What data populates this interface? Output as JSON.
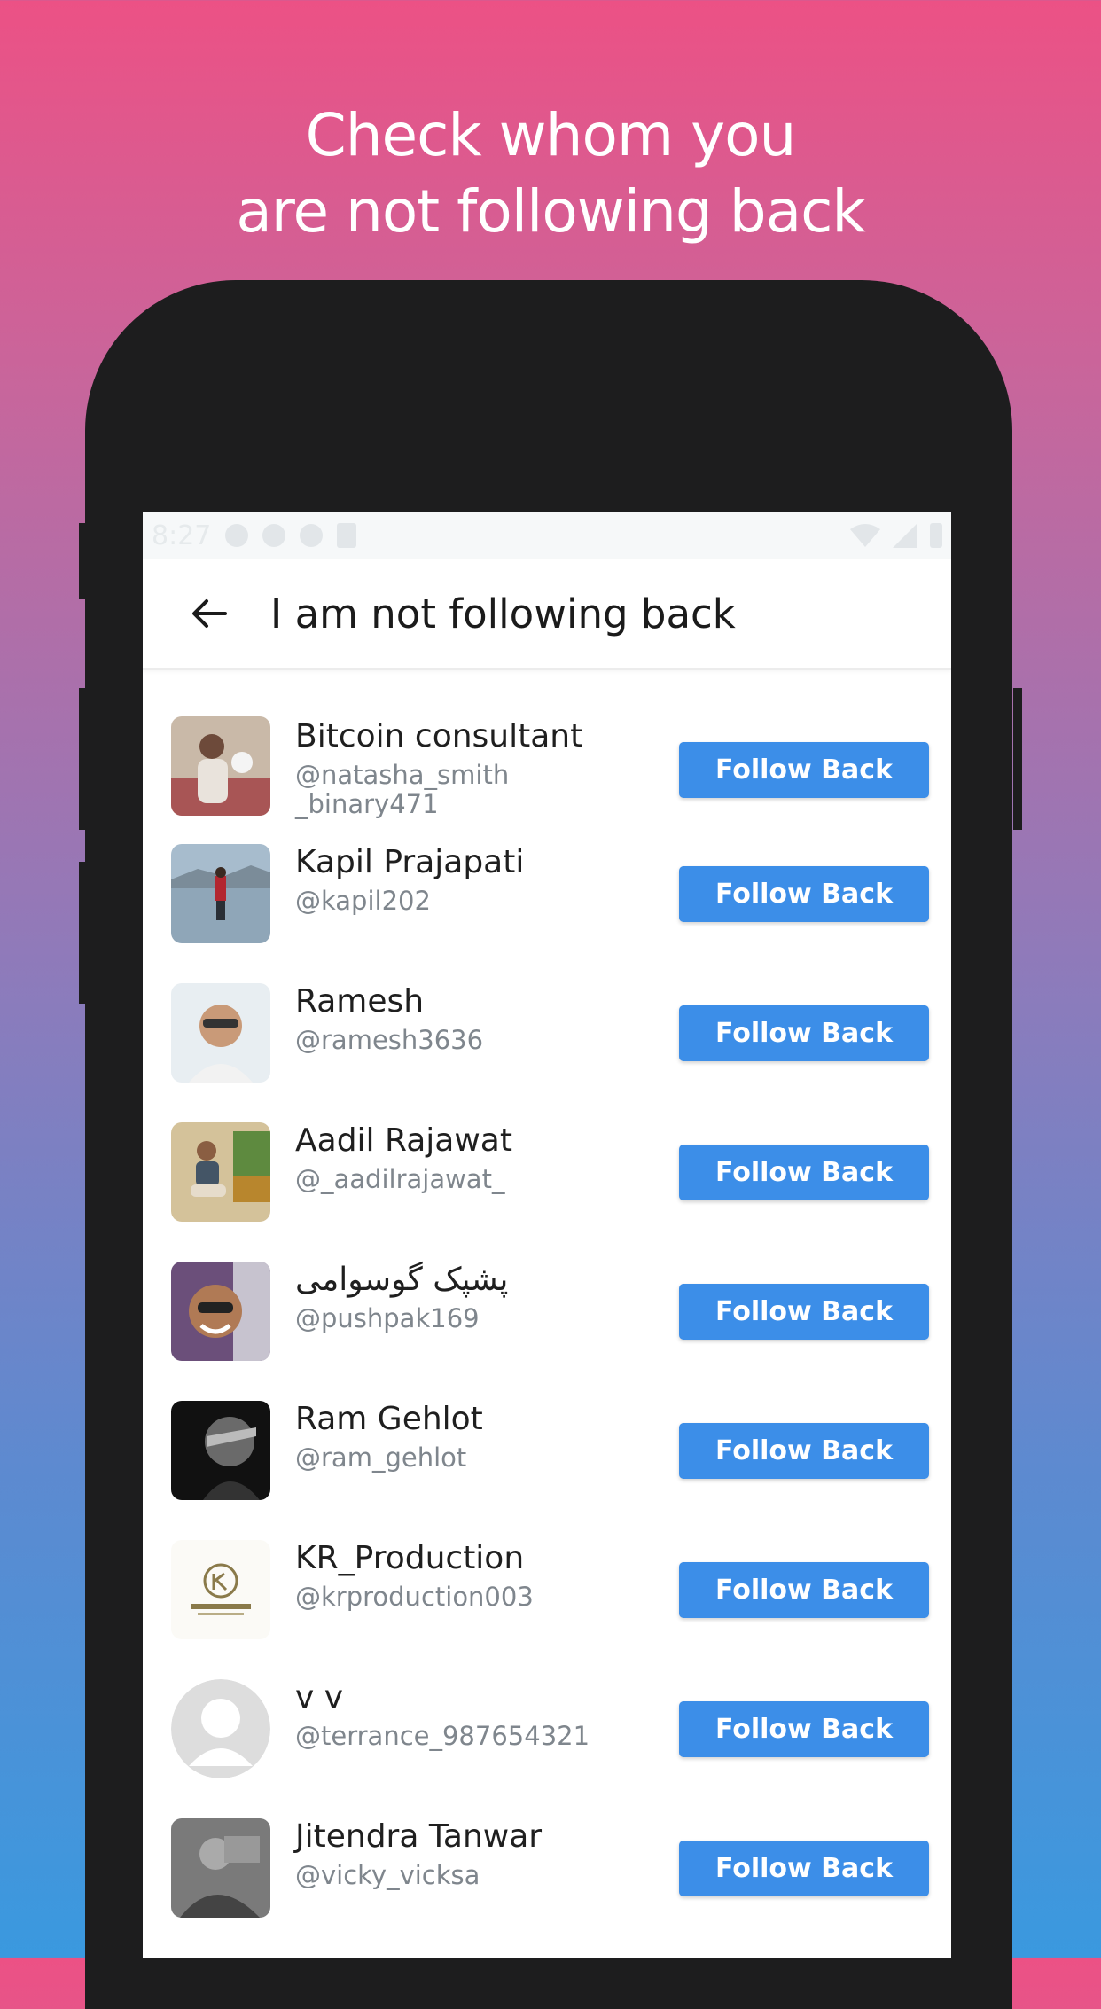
{
  "promo": {
    "line1": "Check whom you",
    "line2": "are not following back"
  },
  "status_bar": {
    "time": "8:27"
  },
  "app_bar": {
    "title": "I am not following back",
    "back_icon": "arrow-left-icon"
  },
  "follow_label": "Follow Back",
  "colors": {
    "button": "#3c8ee8",
    "gradient_top": "#ec5185",
    "gradient_bottom": "#3a99df"
  },
  "users": [
    {
      "name": "Bitcoin consultant",
      "handle": "@natasha_smith _binary471"
    },
    {
      "name": "Kapil Prajapati",
      "handle": "@kapil202"
    },
    {
      "name": "Ramesh",
      "handle": "@ramesh3636"
    },
    {
      "name": "Aadil Rajawat",
      "handle": "@_aadilrajawat_"
    },
    {
      "name": "پشپک گوسوامی",
      "handle": "@pushpak169"
    },
    {
      "name": "Ram Gehlot",
      "handle": "@ram_gehlot"
    },
    {
      "name": "KR_Production",
      "handle": "@krproduction003"
    },
    {
      "name": "v v",
      "handle": "@terrance_987654321"
    },
    {
      "name": "Jitendra Tanwar",
      "handle": "@vicky_vicksa"
    }
  ]
}
